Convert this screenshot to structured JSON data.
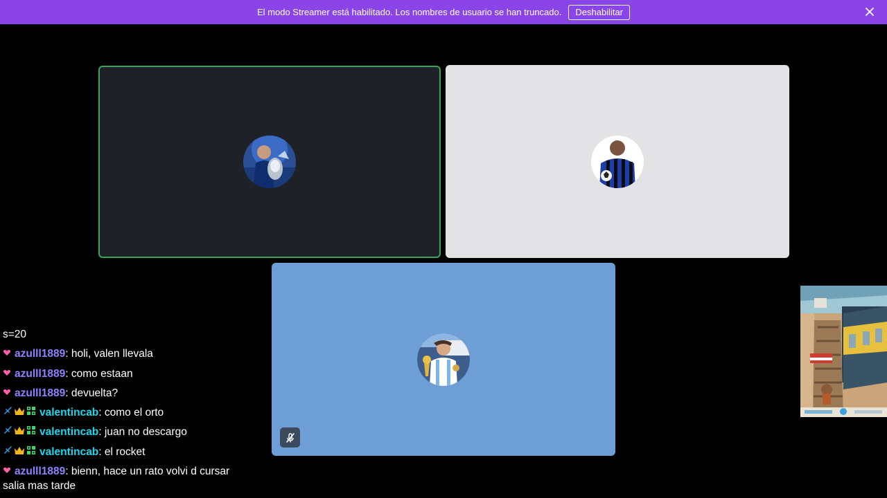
{
  "banner": {
    "text": "El modo Streamer está habilitado. Los nombres de usuario se han truncado.",
    "button_label": "Deshabilitar",
    "close_icon": "close-icon",
    "background": "#8a45e8"
  },
  "tiles": [
    {
      "name": "participant-1",
      "speaking": true,
      "background": "#1f2129",
      "avatar": "player-trophy-avatar"
    },
    {
      "name": "participant-2",
      "speaking": false,
      "background": "#e3e3e5",
      "avatar": "blue-jersey-avatar"
    },
    {
      "name": "participant-3",
      "speaking": false,
      "muted": true,
      "background": "#6d9fd6",
      "avatar": "argentina-trophy-avatar"
    }
  ],
  "chat": {
    "header": "s=20",
    "messages": [
      {
        "user": "azulll1889",
        "text": ": holi, valen llevala"
      },
      {
        "user": "azulll1889",
        "text": ": como estaan"
      },
      {
        "user": "azulll1889",
        "text": ": devuelta?"
      },
      {
        "user": "valentincab",
        "text": ": como el orto"
      },
      {
        "user": "valentincab",
        "text": ": juan no descargo"
      },
      {
        "user": "valentincab",
        "text": ": el rocket"
      },
      {
        "user": "azulll1889",
        "text": ": bienn, hace un rato volvi d cursar"
      }
    ],
    "continuation": "salia mas tarde",
    "colors": {
      "azul": "#8e83ff",
      "valen": "#1fd7ec"
    }
  },
  "game_thumbnail": {
    "name": "subway-runner-game-view"
  }
}
